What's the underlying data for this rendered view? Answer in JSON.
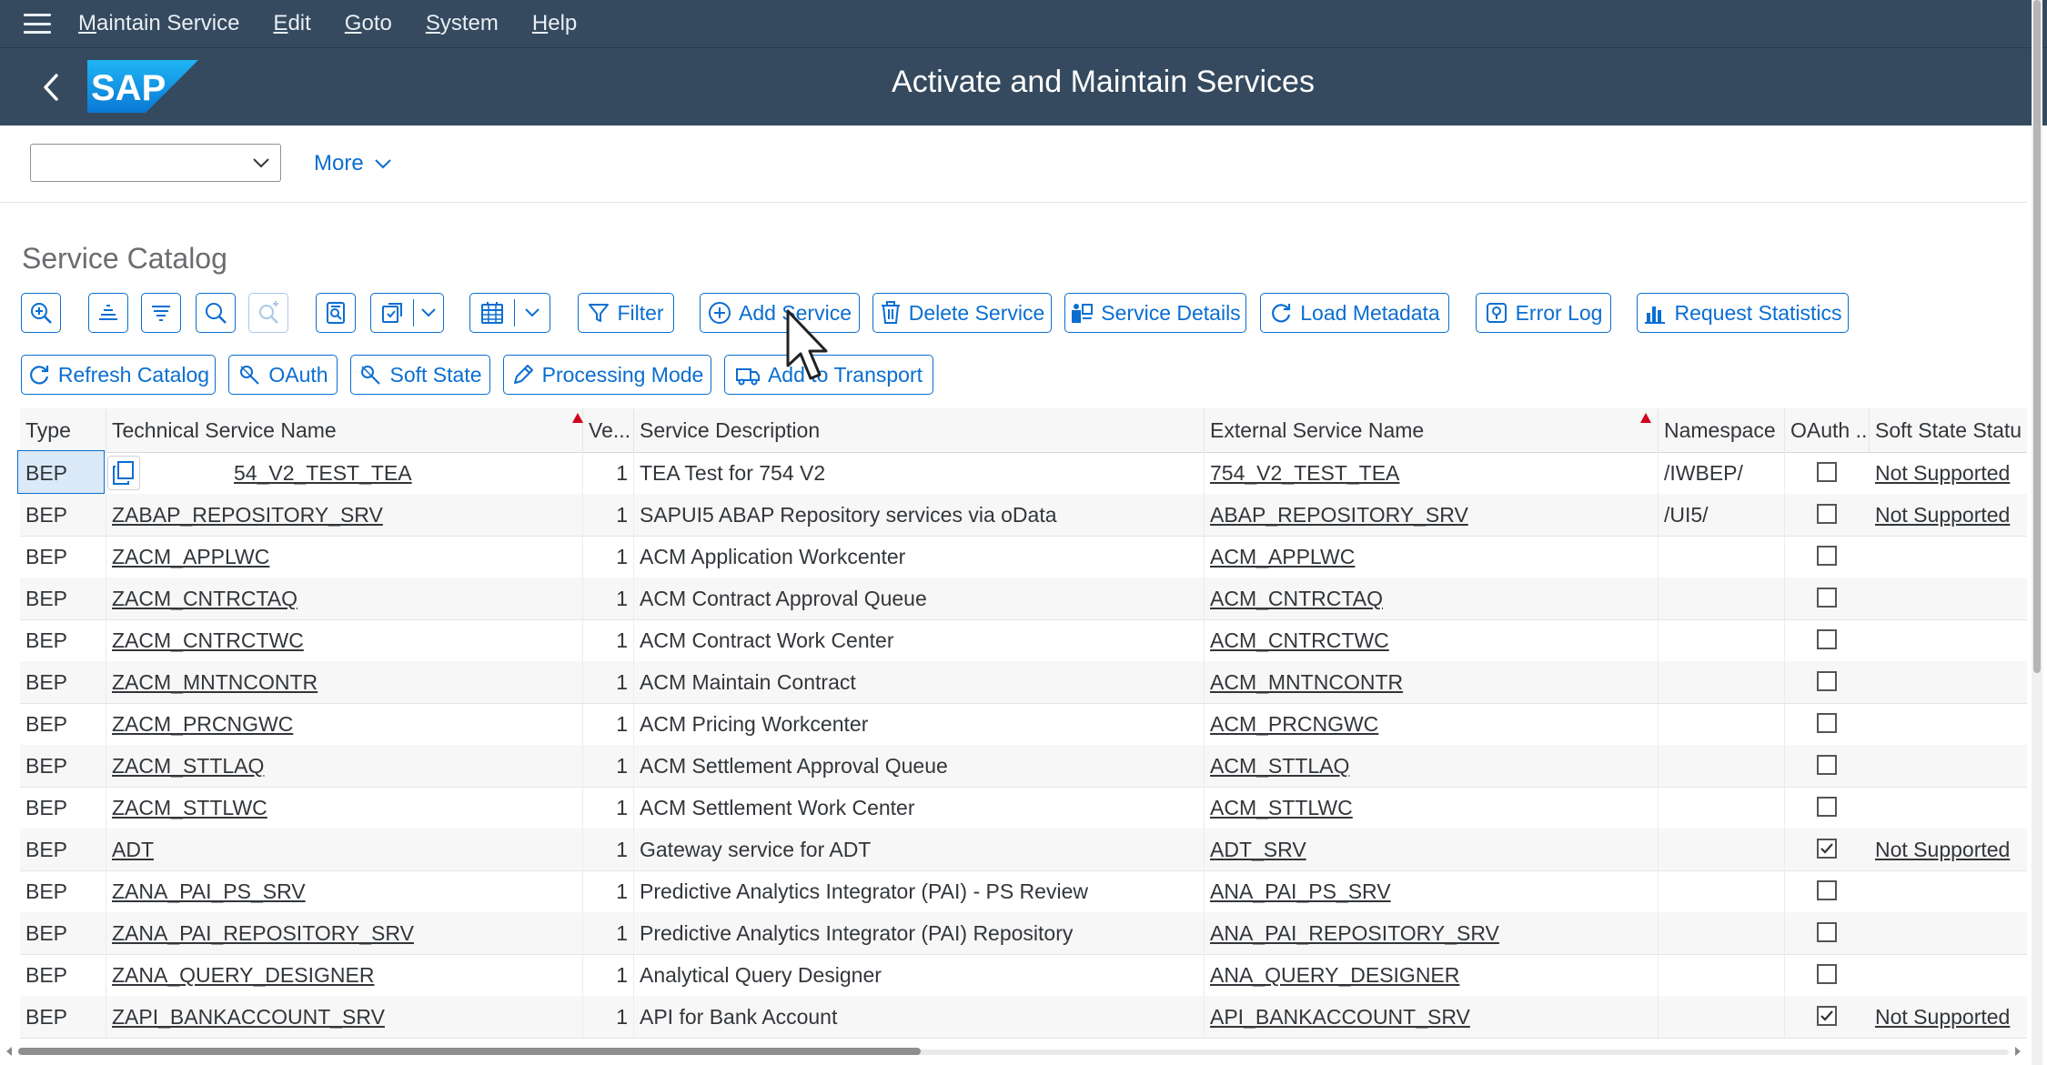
{
  "menubar": {
    "items": [
      {
        "acc": "M",
        "rest": "aintain Service"
      },
      {
        "acc": "E",
        "rest": "dit"
      },
      {
        "acc": "G",
        "rest": "oto"
      },
      {
        "acc": "S",
        "rest": "ystem"
      },
      {
        "acc": "H",
        "rest": "elp"
      }
    ]
  },
  "shell": {
    "logo_text": "SAP",
    "title": "Activate and Maintain Services"
  },
  "subtool": {
    "combo_value": "",
    "more_label": "More"
  },
  "section": {
    "title": "Service Catalog"
  },
  "toolbar": {
    "filter": "Filter",
    "add_service": "Add Service",
    "delete_service": "Delete Service",
    "service_details": "Service Details",
    "load_metadata": "Load Metadata",
    "error_log": "Error Log",
    "request_statistics": "Request Statistics",
    "refresh_catalog": "Refresh Catalog",
    "oauth": "OAuth",
    "soft_state": "Soft State",
    "processing_mode": "Processing Mode",
    "add_to_transport": "Add to Transport"
  },
  "table": {
    "columns": {
      "type": "Type",
      "tech": "Technical Service Name",
      "ver": "Ve...",
      "desc": "Service Description",
      "ext": "External Service Name",
      "ns": "Namespace",
      "oauth": "OAuth ...",
      "soft": "Soft State Statu"
    },
    "rows": [
      {
        "type": "BEP",
        "tech": "54_V2_TEST_TEA",
        "ver": "1",
        "desc": "TEA Test for 754 V2",
        "ext": "754_V2_TEST_TEA",
        "ns": "/IWBEP/",
        "oauth": false,
        "soft": "Not Supported"
      },
      {
        "type": "BEP",
        "tech": "ZABAP_REPOSITORY_SRV",
        "ver": "1",
        "desc": "SAPUI5 ABAP Repository services via oData",
        "ext": "ABAP_REPOSITORY_SRV",
        "ns": "/UI5/",
        "oauth": false,
        "soft": "Not Supported"
      },
      {
        "type": "BEP",
        "tech": "ZACM_APPLWC",
        "ver": "1",
        "desc": "ACM Application Workcenter",
        "ext": "ACM_APPLWC",
        "ns": "",
        "oauth": false,
        "soft": ""
      },
      {
        "type": "BEP",
        "tech": "ZACM_CNTRCTAQ",
        "ver": "1",
        "desc": "ACM Contract Approval Queue",
        "ext": "ACM_CNTRCTAQ",
        "ns": "",
        "oauth": false,
        "soft": ""
      },
      {
        "type": "BEP",
        "tech": "ZACM_CNTRCTWC",
        "ver": "1",
        "desc": "ACM Contract Work Center",
        "ext": "ACM_CNTRCTWC",
        "ns": "",
        "oauth": false,
        "soft": ""
      },
      {
        "type": "BEP",
        "tech": "ZACM_MNTNCONTR",
        "ver": "1",
        "desc": "ACM Maintain Contract",
        "ext": "ACM_MNTNCONTR",
        "ns": "",
        "oauth": false,
        "soft": ""
      },
      {
        "type": "BEP",
        "tech": "ZACM_PRCNGWC",
        "ver": "1",
        "desc": "ACM Pricing Workcenter",
        "ext": "ACM_PRCNGWC",
        "ns": "",
        "oauth": false,
        "soft": ""
      },
      {
        "type": "BEP",
        "tech": "ZACM_STTLAQ",
        "ver": "1",
        "desc": "ACM Settlement Approval Queue",
        "ext": "ACM_STTLAQ",
        "ns": "",
        "oauth": false,
        "soft": ""
      },
      {
        "type": "BEP",
        "tech": "ZACM_STTLWC",
        "ver": "1",
        "desc": "ACM Settlement Work Center",
        "ext": "ACM_STTLWC",
        "ns": "",
        "oauth": false,
        "soft": ""
      },
      {
        "type": "BEP",
        "tech": "ADT",
        "ver": "1",
        "desc": "Gateway service for ADT",
        "ext": "ADT_SRV",
        "ns": "",
        "oauth": true,
        "soft": "Not Supported"
      },
      {
        "type": "BEP",
        "tech": "ZANA_PAI_PS_SRV",
        "ver": "1",
        "desc": "Predictive Analytics Integrator (PAI) - PS Review",
        "ext": "ANA_PAI_PS_SRV",
        "ns": "",
        "oauth": false,
        "soft": ""
      },
      {
        "type": "BEP",
        "tech": "ZANA_PAI_REPOSITORY_SRV",
        "ver": "1",
        "desc": "Predictive Analytics Integrator (PAI) Repository",
        "ext": "ANA_PAI_REPOSITORY_SRV",
        "ns": "",
        "oauth": false,
        "soft": ""
      },
      {
        "type": "BEP",
        "tech": "ZANA_QUERY_DESIGNER",
        "ver": "1",
        "desc": "Analytical Query Designer",
        "ext": "ANA_QUERY_DESIGNER",
        "ns": "",
        "oauth": false,
        "soft": ""
      },
      {
        "type": "BEP",
        "tech": "ZAPI_BANKACCOUNT_SRV",
        "ver": "1",
        "desc": "API for Bank Account",
        "ext": "API_BANKACCOUNT_SRV",
        "ns": "",
        "oauth": true,
        "soft": "Not Supported"
      }
    ]
  },
  "colors": {
    "shell": "#354a5f",
    "accent": "#0a6ed1",
    "sort_marker": "#d0021b"
  }
}
